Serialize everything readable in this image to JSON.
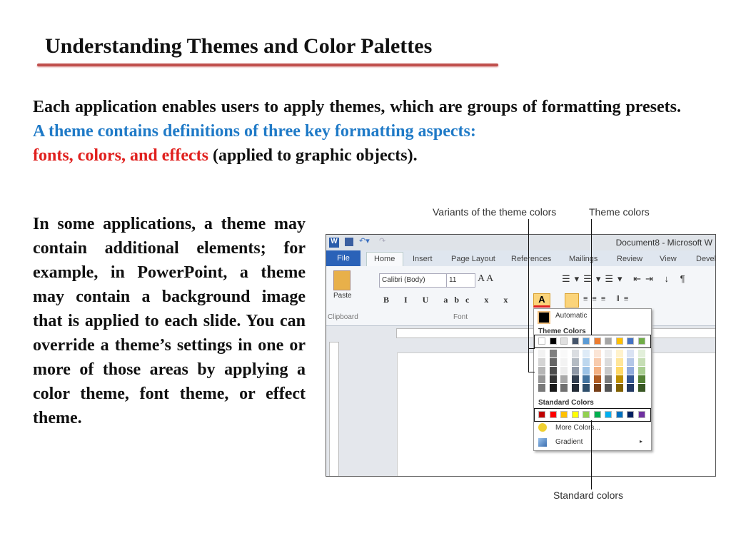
{
  "title": "Understanding Themes and Color Palettes",
  "para1": {
    "text1": "Each application enables users to apply themes, which are groups of formatting presets. ",
    "text2": "A theme contains definitions of three key formatting aspects:",
    "text3": "fonts, colors, and effects",
    "text4": " (applied to graphic objects)."
  },
  "para2": "In some applications, a theme may contain additional elements; for example, in PowerPoint, a theme may contain a background image that is applied to each slide. You can override a theme’s settings in one or more of those areas by applying a color theme, font theme, or effect theme.",
  "callouts": {
    "variants": "Variants of the theme colors",
    "theme": "Theme colors",
    "standard": "Standard colors"
  },
  "word": {
    "window_title": "Document8 - Microsoft W",
    "tabs": [
      "File",
      "Home",
      "Insert",
      "Page Layout",
      "References",
      "Mailings",
      "Review",
      "View",
      "Devel"
    ],
    "font_name": "Calibri (Body)",
    "font_size": "11",
    "groups": [
      "Clipboard",
      "Font"
    ],
    "paste": "Paste",
    "menu": {
      "automatic": "Automatic",
      "theme_colors": "Theme Colors",
      "standard_colors": "Standard Colors",
      "more_colors": "More Colors...",
      "gradient": "Gradient"
    },
    "theme_colors": [
      "#ffffff",
      "#000000",
      "#e0e0e0",
      "#44546a",
      "#5b9bd5",
      "#ed7d31",
      "#a5a5a5",
      "#ffc000",
      "#4472c4",
      "#70ad47"
    ],
    "standard_colors": [
      "#c00000",
      "#ff0000",
      "#ffc000",
      "#ffff00",
      "#92d050",
      "#00b050",
      "#00b0f0",
      "#0070c0",
      "#002060",
      "#7030a0"
    ]
  }
}
